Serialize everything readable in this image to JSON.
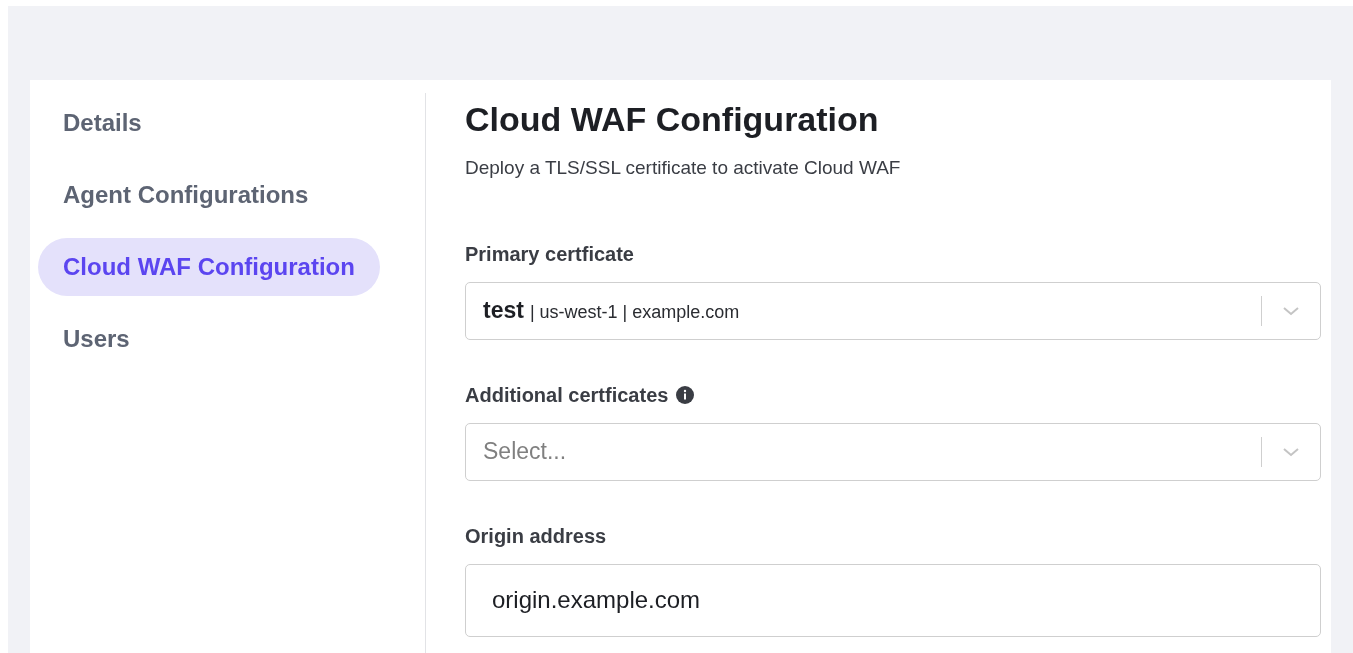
{
  "sidebar": {
    "items": [
      {
        "label": "Details",
        "selected": false
      },
      {
        "label": "Agent Configurations",
        "selected": false
      },
      {
        "label": "Cloud WAF Configuration",
        "selected": true
      },
      {
        "label": "Users",
        "selected": false
      }
    ]
  },
  "main": {
    "title": "Cloud WAF Configuration",
    "subtitle": "Deploy a TLS/SSL certificate to activate Cloud WAF",
    "fields": [
      {
        "kind": "select",
        "label": "Primary certficate",
        "info": false,
        "value": {
          "name": "test",
          "details": "| us-west-1 | example.com"
        }
      },
      {
        "kind": "select",
        "label": "Additional certficates",
        "info": true,
        "placeholder": "Select..."
      },
      {
        "kind": "input",
        "label": "Origin address",
        "info": false,
        "value": "origin.example.com"
      }
    ]
  }
}
